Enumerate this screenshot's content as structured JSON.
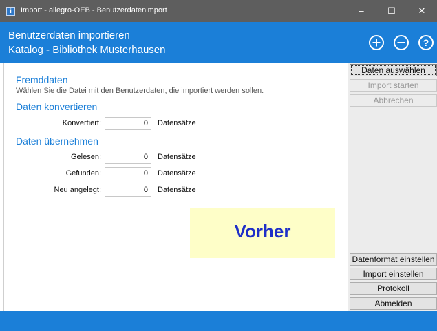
{
  "window": {
    "title": "Import - allegro-OEB - Benutzerdatenimport",
    "minimize_glyph": "–",
    "maximize_glyph": "☐",
    "close_glyph": "✕"
  },
  "header": {
    "line1": "Benutzerdaten importieren",
    "line2": "Katalog - Bibliothek Musterhausen",
    "icons": [
      "plus-circle-icon",
      "minus-circle-icon",
      "help-circle-icon"
    ]
  },
  "main": {
    "fremddaten": {
      "heading": "Fremddaten",
      "hint": "Wählen Sie die Datei mit den Benutzerdaten, die importiert werden sollen."
    },
    "konvertieren": {
      "heading": "Daten konvertieren",
      "rows": [
        {
          "label": "Konvertiert:",
          "value": "0",
          "unit": "Datensätze"
        }
      ]
    },
    "uebernehmen": {
      "heading": "Daten übernehmen",
      "rows": [
        {
          "label": "Gelesen:",
          "value": "0",
          "unit": "Datensätze"
        },
        {
          "label": "Gefunden:",
          "value": "0",
          "unit": "Datensätze"
        },
        {
          "label": "Neu angelegt:",
          "value": "0",
          "unit": "Datensätze"
        }
      ]
    },
    "status_text": "Vorher"
  },
  "sidebar": {
    "top_buttons": [
      {
        "label": "Daten auswählen",
        "enabled": true
      },
      {
        "label": "Import starten",
        "enabled": false
      },
      {
        "label": "Abbrechen",
        "enabled": false
      }
    ],
    "bottom_buttons": [
      {
        "label": "Datenformat einstellen"
      },
      {
        "label": "Import einstellen"
      },
      {
        "label": "Protokoll"
      },
      {
        "label": "Abmelden"
      }
    ]
  },
  "colors": {
    "accent": "#1b7fd8",
    "titlebar": "#5e5e5e",
    "status_box": "#fefec8",
    "status_text": "#1f2fc8"
  }
}
